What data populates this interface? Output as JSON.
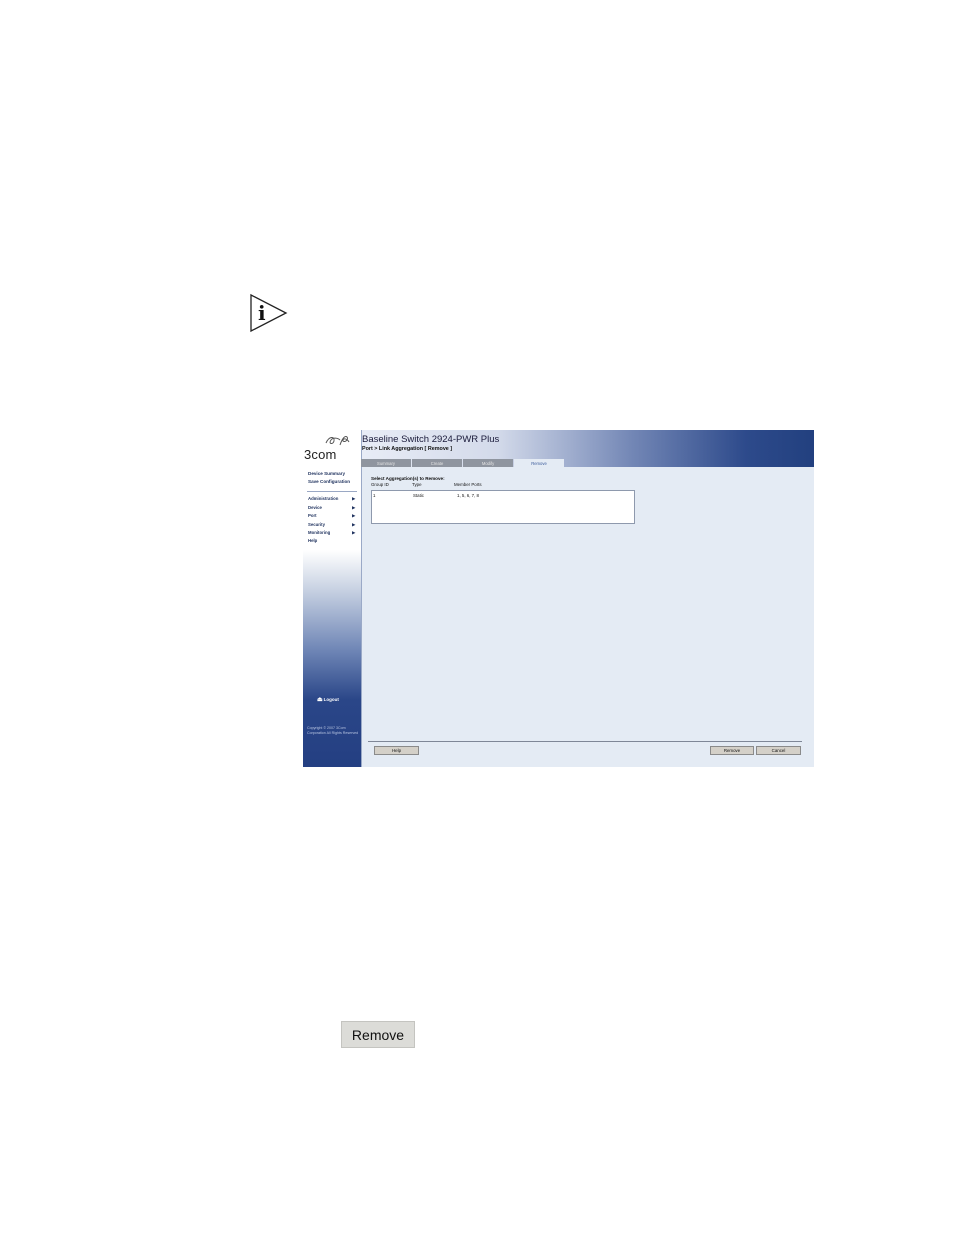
{
  "note_icon": "info-icon",
  "screenshot": {
    "logo": "3com",
    "sidebar": {
      "links": [
        "Device Summary",
        "Save Configuration"
      ],
      "nav": [
        "Administration",
        "Device",
        "Port",
        "Security",
        "Monitoring",
        "Help"
      ],
      "logout": "Logout",
      "copyright": "Copyright © 2007 3Com Corporation All Rights Reserved"
    },
    "title": "Baseline Switch 2924-PWR Plus",
    "breadcrumb": "Port > Link Aggregation [ Remove ]",
    "tabs": [
      "Summary",
      "Create",
      "Modify",
      "Remove"
    ],
    "active_tab": "Remove",
    "select_label": "Select Aggregation(s) to Remove:",
    "columns": [
      "Group ID",
      "Type",
      "Member Ports"
    ],
    "rows": [
      {
        "group_id": "1",
        "type": "Static",
        "member_ports": "1, 5, 6, 7, 8"
      }
    ],
    "buttons": {
      "help": "Help",
      "remove": "Remove",
      "cancel": "Cancel"
    }
  },
  "remove_button_label": "Remove"
}
